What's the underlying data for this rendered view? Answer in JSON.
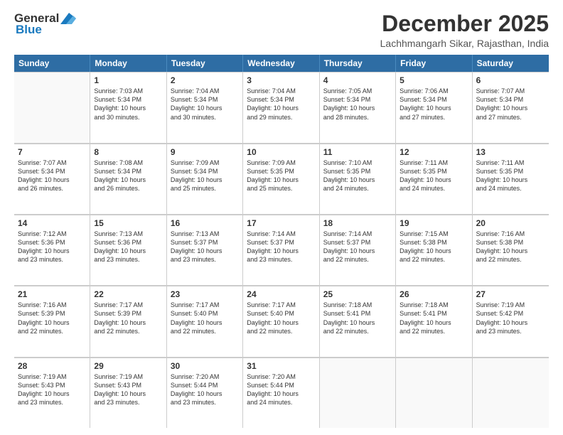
{
  "logo": {
    "general": "General",
    "blue": "Blue"
  },
  "title": "December 2025",
  "location": "Lachhmangarh Sikar, Rajasthan, India",
  "header_days": [
    "Sunday",
    "Monday",
    "Tuesday",
    "Wednesday",
    "Thursday",
    "Friday",
    "Saturday"
  ],
  "weeks": [
    [
      {
        "day": "",
        "info": ""
      },
      {
        "day": "1",
        "info": "Sunrise: 7:03 AM\nSunset: 5:34 PM\nDaylight: 10 hours\nand 30 minutes."
      },
      {
        "day": "2",
        "info": "Sunrise: 7:04 AM\nSunset: 5:34 PM\nDaylight: 10 hours\nand 30 minutes."
      },
      {
        "day": "3",
        "info": "Sunrise: 7:04 AM\nSunset: 5:34 PM\nDaylight: 10 hours\nand 29 minutes."
      },
      {
        "day": "4",
        "info": "Sunrise: 7:05 AM\nSunset: 5:34 PM\nDaylight: 10 hours\nand 28 minutes."
      },
      {
        "day": "5",
        "info": "Sunrise: 7:06 AM\nSunset: 5:34 PM\nDaylight: 10 hours\nand 27 minutes."
      },
      {
        "day": "6",
        "info": "Sunrise: 7:07 AM\nSunset: 5:34 PM\nDaylight: 10 hours\nand 27 minutes."
      }
    ],
    [
      {
        "day": "7",
        "info": "Sunrise: 7:07 AM\nSunset: 5:34 PM\nDaylight: 10 hours\nand 26 minutes."
      },
      {
        "day": "8",
        "info": "Sunrise: 7:08 AM\nSunset: 5:34 PM\nDaylight: 10 hours\nand 26 minutes."
      },
      {
        "day": "9",
        "info": "Sunrise: 7:09 AM\nSunset: 5:34 PM\nDaylight: 10 hours\nand 25 minutes."
      },
      {
        "day": "10",
        "info": "Sunrise: 7:09 AM\nSunset: 5:35 PM\nDaylight: 10 hours\nand 25 minutes."
      },
      {
        "day": "11",
        "info": "Sunrise: 7:10 AM\nSunset: 5:35 PM\nDaylight: 10 hours\nand 24 minutes."
      },
      {
        "day": "12",
        "info": "Sunrise: 7:11 AM\nSunset: 5:35 PM\nDaylight: 10 hours\nand 24 minutes."
      },
      {
        "day": "13",
        "info": "Sunrise: 7:11 AM\nSunset: 5:35 PM\nDaylight: 10 hours\nand 24 minutes."
      }
    ],
    [
      {
        "day": "14",
        "info": "Sunrise: 7:12 AM\nSunset: 5:36 PM\nDaylight: 10 hours\nand 23 minutes."
      },
      {
        "day": "15",
        "info": "Sunrise: 7:13 AM\nSunset: 5:36 PM\nDaylight: 10 hours\nand 23 minutes."
      },
      {
        "day": "16",
        "info": "Sunrise: 7:13 AM\nSunset: 5:37 PM\nDaylight: 10 hours\nand 23 minutes."
      },
      {
        "day": "17",
        "info": "Sunrise: 7:14 AM\nSunset: 5:37 PM\nDaylight: 10 hours\nand 23 minutes."
      },
      {
        "day": "18",
        "info": "Sunrise: 7:14 AM\nSunset: 5:37 PM\nDaylight: 10 hours\nand 22 minutes."
      },
      {
        "day": "19",
        "info": "Sunrise: 7:15 AM\nSunset: 5:38 PM\nDaylight: 10 hours\nand 22 minutes."
      },
      {
        "day": "20",
        "info": "Sunrise: 7:16 AM\nSunset: 5:38 PM\nDaylight: 10 hours\nand 22 minutes."
      }
    ],
    [
      {
        "day": "21",
        "info": "Sunrise: 7:16 AM\nSunset: 5:39 PM\nDaylight: 10 hours\nand 22 minutes."
      },
      {
        "day": "22",
        "info": "Sunrise: 7:17 AM\nSunset: 5:39 PM\nDaylight: 10 hours\nand 22 minutes."
      },
      {
        "day": "23",
        "info": "Sunrise: 7:17 AM\nSunset: 5:40 PM\nDaylight: 10 hours\nand 22 minutes."
      },
      {
        "day": "24",
        "info": "Sunrise: 7:17 AM\nSunset: 5:40 PM\nDaylight: 10 hours\nand 22 minutes."
      },
      {
        "day": "25",
        "info": "Sunrise: 7:18 AM\nSunset: 5:41 PM\nDaylight: 10 hours\nand 22 minutes."
      },
      {
        "day": "26",
        "info": "Sunrise: 7:18 AM\nSunset: 5:41 PM\nDaylight: 10 hours\nand 22 minutes."
      },
      {
        "day": "27",
        "info": "Sunrise: 7:19 AM\nSunset: 5:42 PM\nDaylight: 10 hours\nand 23 minutes."
      }
    ],
    [
      {
        "day": "28",
        "info": "Sunrise: 7:19 AM\nSunset: 5:43 PM\nDaylight: 10 hours\nand 23 minutes."
      },
      {
        "day": "29",
        "info": "Sunrise: 7:19 AM\nSunset: 5:43 PM\nDaylight: 10 hours\nand 23 minutes."
      },
      {
        "day": "30",
        "info": "Sunrise: 7:20 AM\nSunset: 5:44 PM\nDaylight: 10 hours\nand 23 minutes."
      },
      {
        "day": "31",
        "info": "Sunrise: 7:20 AM\nSunset: 5:44 PM\nDaylight: 10 hours\nand 24 minutes."
      },
      {
        "day": "",
        "info": ""
      },
      {
        "day": "",
        "info": ""
      },
      {
        "day": "",
        "info": ""
      }
    ]
  ]
}
